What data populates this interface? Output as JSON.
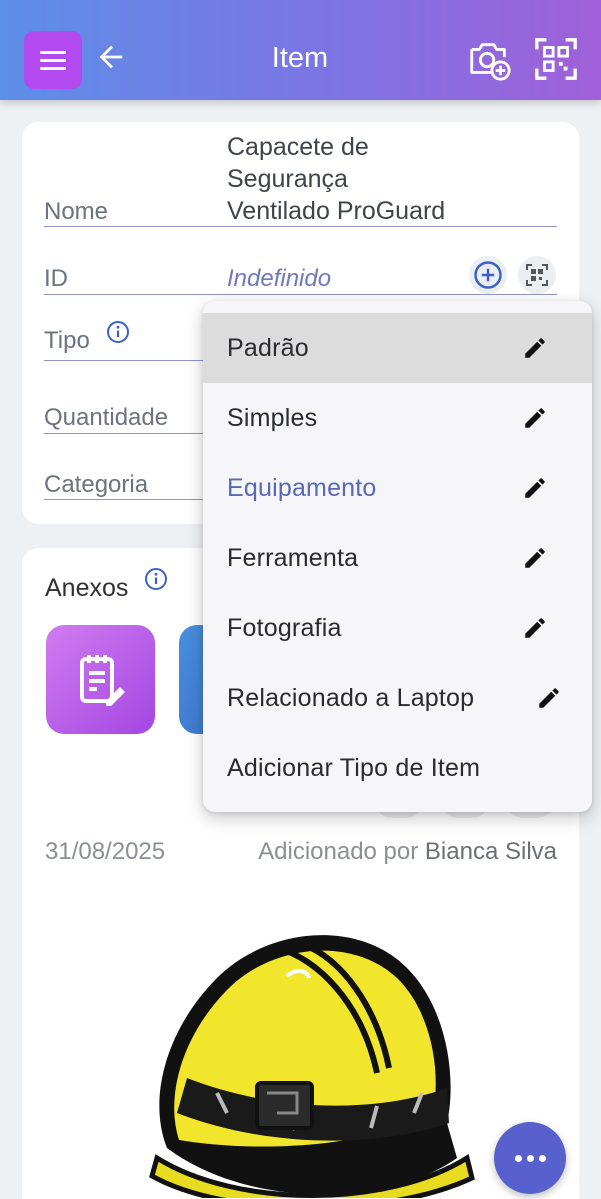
{
  "header": {
    "title": "Item",
    "menu_icon": "hamburger-menu-icon",
    "back_icon": "arrow-left-icon",
    "camera_icon": "camera-add-icon",
    "qr_icon": "qr-scan-icon"
  },
  "form": {
    "nome": {
      "label": "Nome",
      "value_lines": [
        "Capacete de",
        "Segurança",
        "Ventilado ProGuard"
      ]
    },
    "id": {
      "label": "ID",
      "value": "Indefinido"
    },
    "tipo": {
      "label": "Tipo"
    },
    "quantidade": {
      "label": "Quantidade"
    },
    "categoria": {
      "label": "Categoria"
    }
  },
  "anexos": {
    "title": "Anexos",
    "date": "31/08/2025",
    "added_by_prefix": "Adicionado por",
    "added_by_name": "Bianca Silva"
  },
  "dropdown": {
    "items": [
      {
        "label": "Padrão",
        "editable": true
      },
      {
        "label": "Simples",
        "editable": true
      },
      {
        "label": "Equipamento",
        "editable": true
      },
      {
        "label": "Ferramenta",
        "editable": true
      },
      {
        "label": "Fotografia",
        "editable": true
      },
      {
        "label": "Relacionado a Laptop",
        "editable": true
      },
      {
        "label": "Adicionar Tipo de Item",
        "editable": false
      }
    ],
    "highlighted": "Padrão",
    "current": "Equipamento"
  },
  "colors": {
    "header_start": "#5d8ee8",
    "header_end": "#a060d8",
    "menu_button": "#b24af0",
    "accent": "#5a67b8",
    "fab": "#5760cc"
  }
}
